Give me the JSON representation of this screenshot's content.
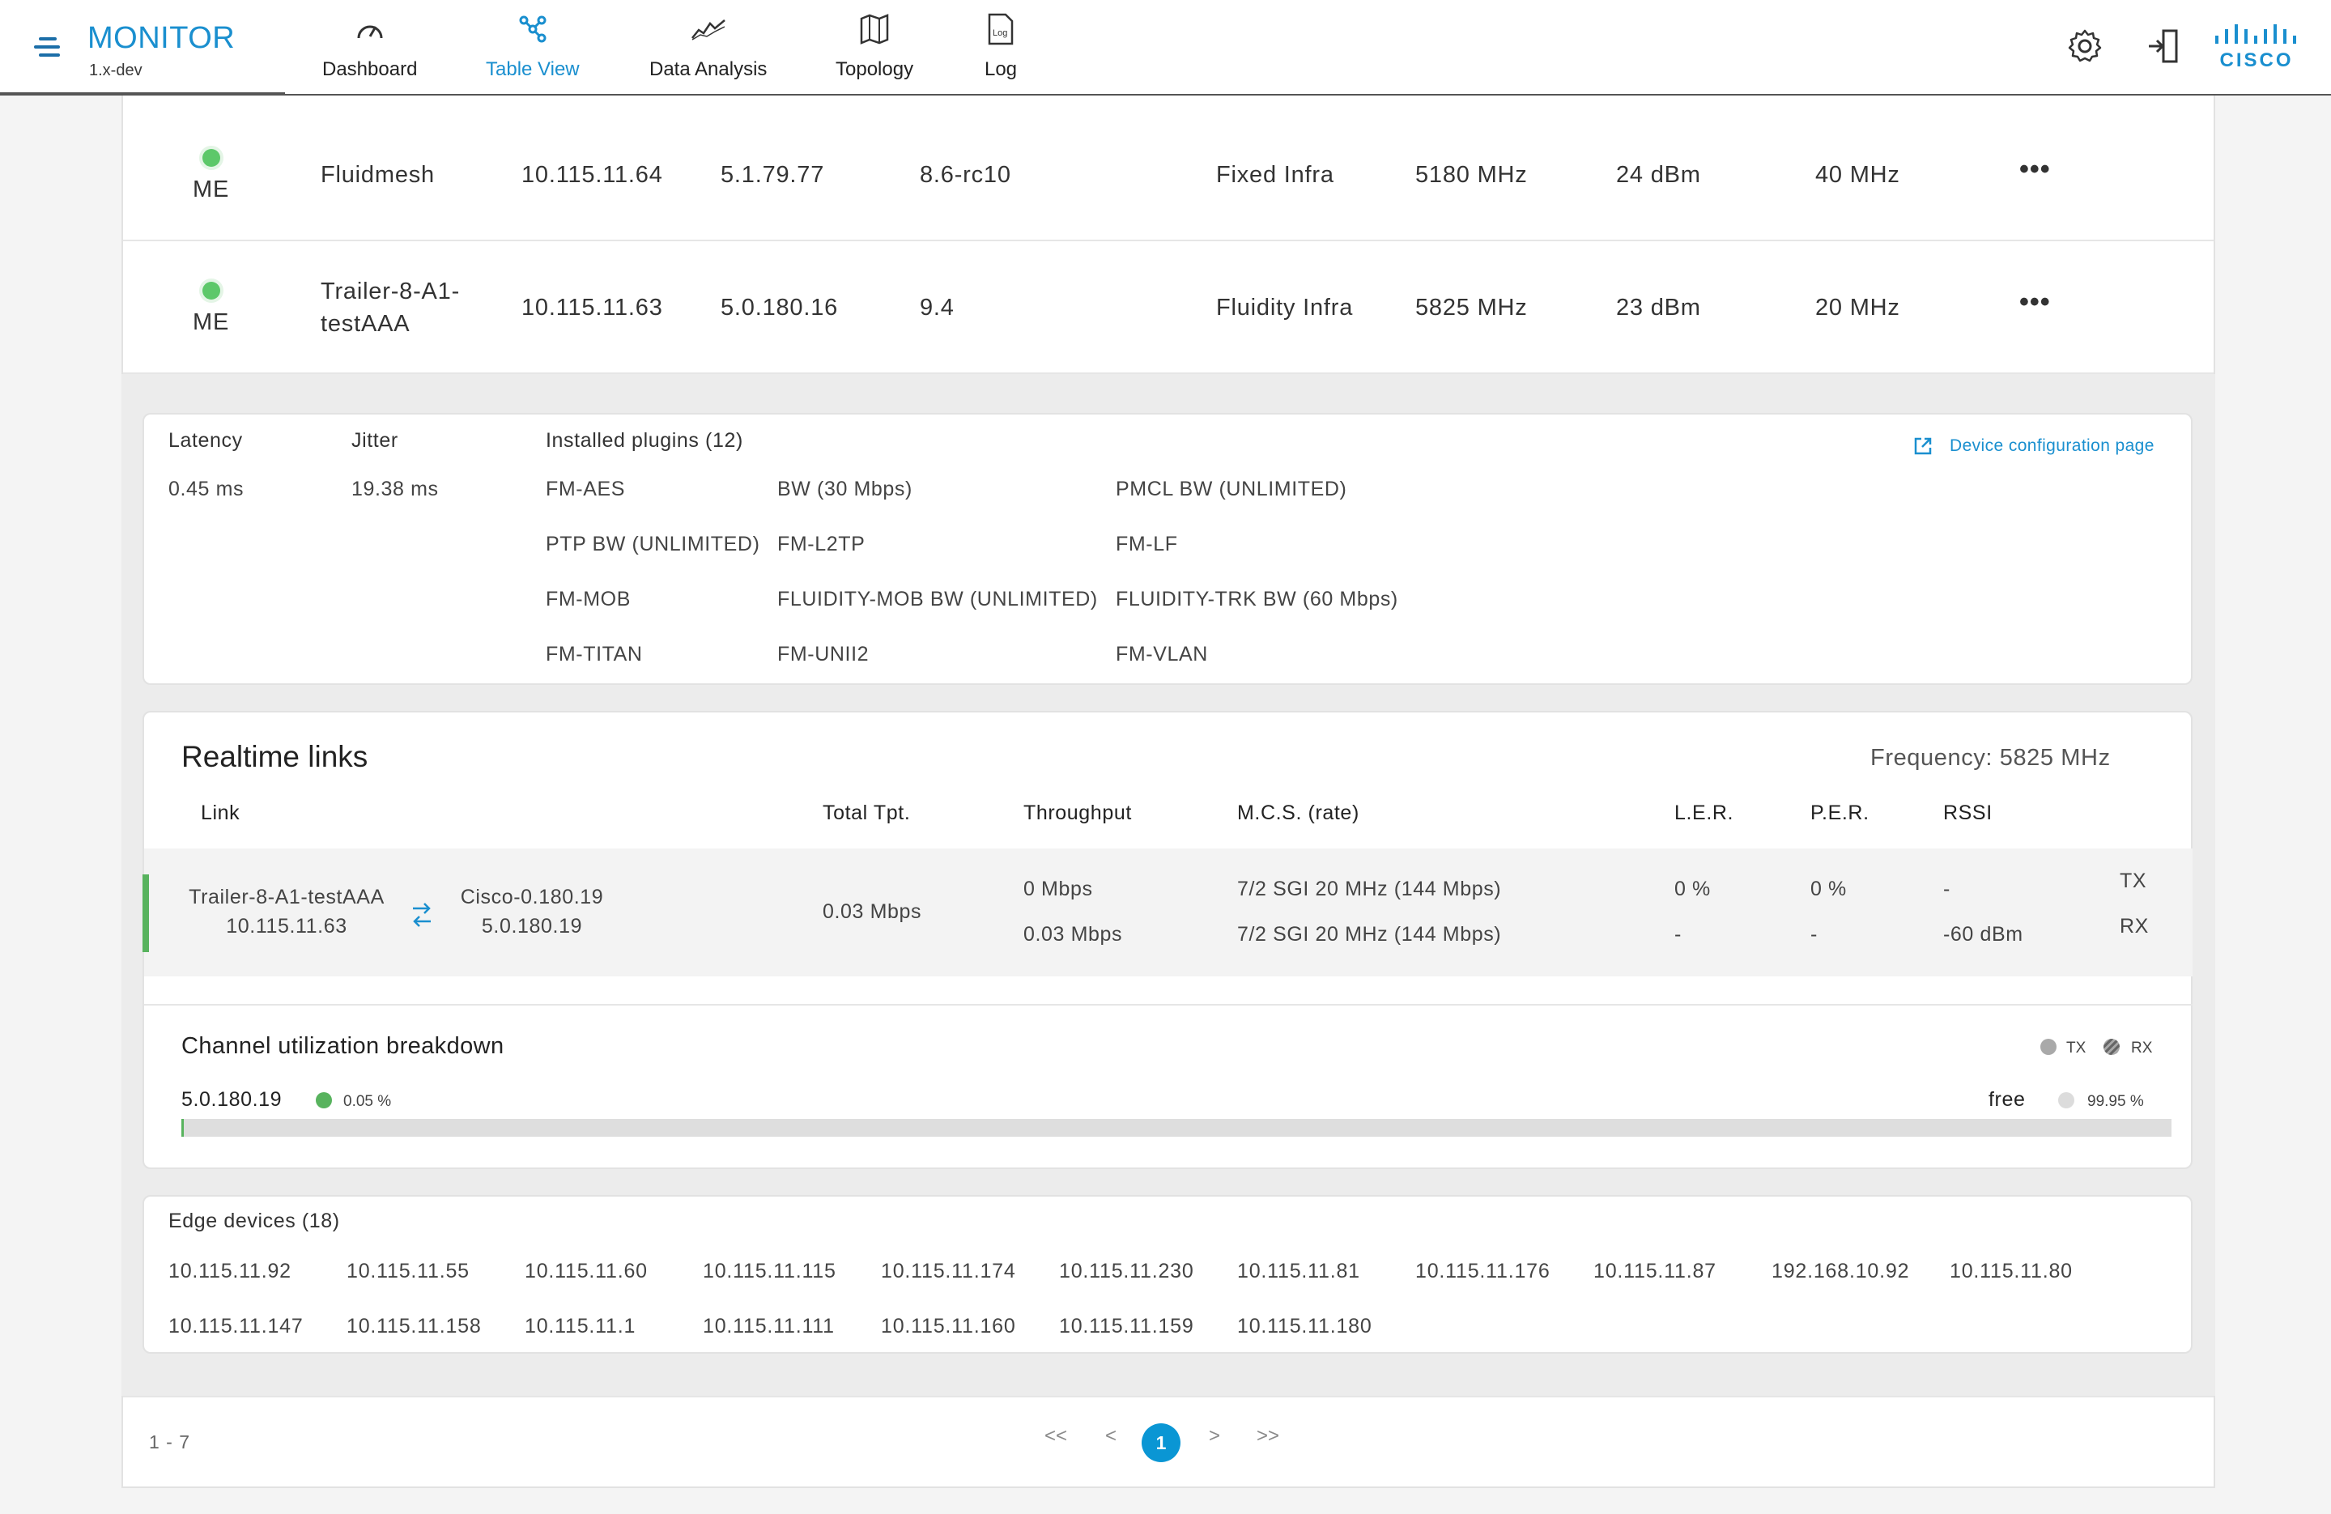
{
  "app": {
    "title": "MONITOR",
    "version": "1.x-dev"
  },
  "nav": {
    "tabs": [
      {
        "label": "Dashboard",
        "icon": "gauge-icon"
      },
      {
        "label": "Table View",
        "icon": "network-nodes-icon",
        "active": true
      },
      {
        "label": "Data Analysis",
        "icon": "line-chart-icon"
      },
      {
        "label": "Topology",
        "icon": "map-icon"
      },
      {
        "label": "Log",
        "icon": "log-file-icon"
      }
    ],
    "log_icon_text": "Log",
    "cisco_logo_text": "CISCO"
  },
  "colors": {
    "accent": "#1a8fcf",
    "status_ok": "#5dc86a",
    "pager_active": "#0a96d4"
  },
  "devices": [
    {
      "role": "ME",
      "name": "Fluidmesh",
      "ip": "10.115.11.64",
      "mesh_id": "5.1.79.77",
      "firmware": "8.6-rc10",
      "mode": "Fixed Infra",
      "frequency": "5180 MHz",
      "power": "24 dBm",
      "channel_width": "40 MHz",
      "more": "•••"
    },
    {
      "role": "ME",
      "name": "Trailer-8-A1-",
      "name_line2": "testAAA",
      "ip": "10.115.11.63",
      "mesh_id": "5.0.180.16",
      "firmware": "9.4",
      "mode": "Fluidity Infra",
      "frequency": "5825 MHz",
      "power": "23 dBm",
      "channel_width": "20 MHz",
      "more": "•••"
    }
  ],
  "details": {
    "latency_label": "Latency",
    "latency_value": "0.45 ms",
    "jitter_label": "Jitter",
    "jitter_value": "19.38 ms",
    "plugins_label": "Installed plugins (12)",
    "plugins": [
      "FM-AES",
      "BW (30 Mbps)",
      "PMCL BW (UNLIMITED)",
      "PTP BW (UNLIMITED)",
      "FM-L2TP",
      "FM-LF",
      "FM-MOB",
      "FLUIDITY-MOB BW (UNLIMITED)",
      "FLUIDITY-TRK BW (60 Mbps)",
      "FM-TITAN",
      "FM-UNII2",
      "FM-VLAN"
    ],
    "config_link": "Device configuration page"
  },
  "realtime": {
    "title": "Realtime links",
    "frequency": "Frequency: 5825 MHz",
    "headers": {
      "link": "Link",
      "total": "Total Tpt.",
      "throughput": "Throughput",
      "mcs": "M.C.S. (rate)",
      "ler": "L.E.R.",
      "per": "P.E.R.",
      "rssi": "RSSI"
    },
    "link": {
      "local_name": "Trailer-8-A1-testAAA",
      "local_ip": "10.115.11.63",
      "remote_name": "Cisco-0.180.19",
      "remote_ip": "5.0.180.19",
      "total": "0.03 Mbps",
      "tx": {
        "throughput": "0 Mbps",
        "mcs": "7/2 SGI 20 MHz (144 Mbps)",
        "ler": "0 %",
        "per": "0 %",
        "rssi": "-",
        "dir": "TX"
      },
      "rx": {
        "throughput": "0.03 Mbps",
        "mcs": "7/2 SGI 20 MHz (144 Mbps)",
        "ler": "-",
        "per": "-",
        "rssi": "-60 dBm",
        "dir": "RX"
      }
    }
  },
  "channel_util": {
    "title": "Channel utilization breakdown",
    "legend_tx": "TX",
    "legend_rx": "RX",
    "node": "5.0.180.19",
    "node_pct": "0.05 %",
    "node_fraction": 0.0005,
    "free_label": "free",
    "free_pct": "99.95 %"
  },
  "edge_devices": {
    "title": "Edge devices (18)",
    "ips": [
      "10.115.11.92",
      "10.115.11.55",
      "10.115.11.60",
      "10.115.11.115",
      "10.115.11.174",
      "10.115.11.230",
      "10.115.11.81",
      "10.115.11.176",
      "10.115.11.87",
      "192.168.10.92",
      "10.115.11.80",
      "10.115.11.147",
      "10.115.11.158",
      "10.115.11.1",
      "10.115.11.111",
      "10.115.11.160",
      "10.115.11.159",
      "10.115.11.180"
    ]
  },
  "pagination": {
    "range": "1 - 7",
    "first": "<<",
    "prev": "<",
    "current": "1",
    "next": ">",
    "last": ">>"
  }
}
